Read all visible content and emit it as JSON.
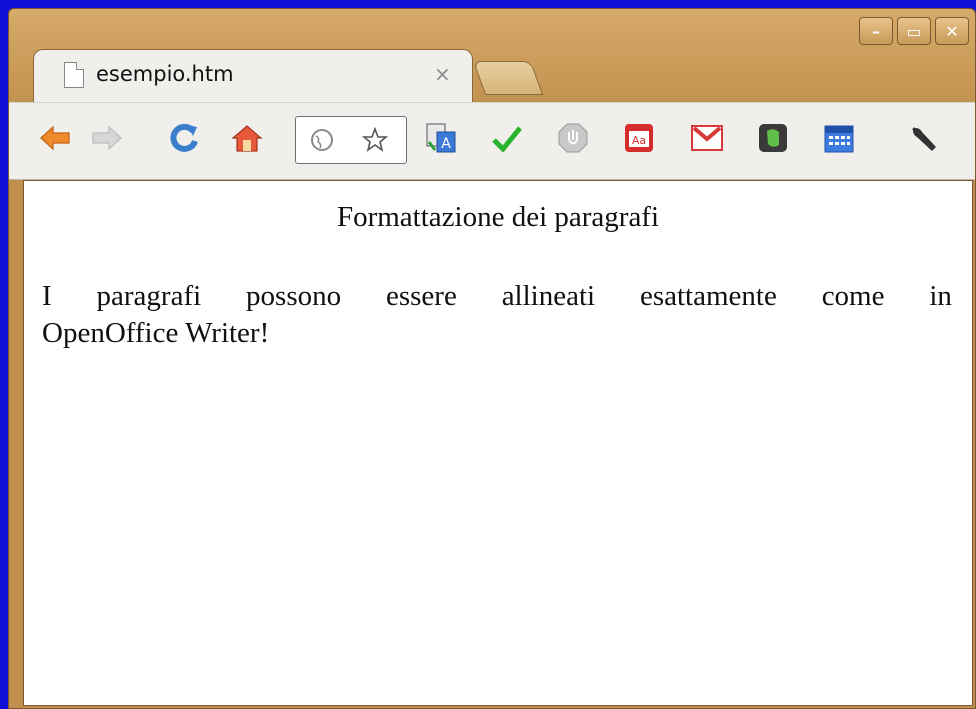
{
  "window": {
    "title": "esempio.htm"
  },
  "tab": {
    "title": "esempio.htm",
    "close": "×"
  },
  "toolbar": {
    "icons": [
      "back-icon",
      "forward-icon",
      "reload-icon",
      "home-icon",
      "globe-icon",
      "star-icon",
      "translate-icon",
      "check-icon",
      "stop-icon",
      "dictionary-icon",
      "gmail-icon",
      "evernote-icon",
      "calendar-icon",
      "wrench-icon"
    ]
  },
  "page": {
    "heading": "Formattazione dei paragrafi",
    "paragraph_line1_words": [
      "I",
      "paragrafi",
      "possono",
      "essere",
      "allineati",
      "esattamente",
      "come",
      "in"
    ],
    "paragraph_line2": "OpenOffice Writer!"
  },
  "colors": {
    "frame": "#c99a58",
    "desktop": "#1010d8",
    "toolbar": "#f1efec"
  }
}
